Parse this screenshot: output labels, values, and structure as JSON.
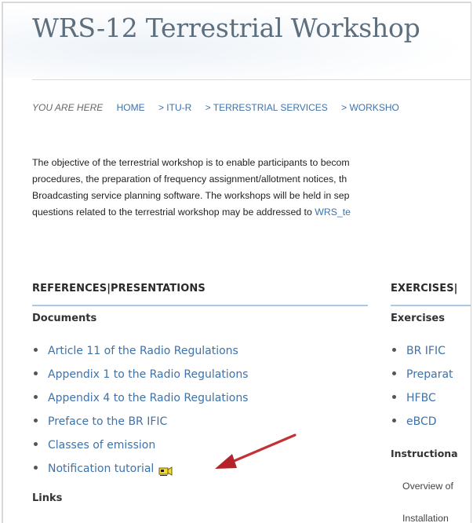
{
  "page": {
    "title": "WRS-12 Terrestrial Workshop"
  },
  "breadcrumb": {
    "here_label": "YOU ARE HERE",
    "items": [
      "HOME",
      "> ITU-R",
      "> TERRESTRIAL SERVICES",
      "> WORKSHO"
    ]
  },
  "intro": {
    "line1": "The objective of the terrestrial workshop is to enable participants to becom",
    "line2": "procedures, the preparation of frequency assignment/allotment notices, th",
    "line3": "Broadcasting service planning software. The workshops will be held in sep",
    "line4_text": "questions related to the terrestrial workshop may be addressed to ",
    "line4_link": "WRS_te"
  },
  "left_column": {
    "heading": "REFERENCES|PRESENTATIONS",
    "documents_heading": "Documents",
    "documents": [
      "Article 11 of the Radio Regulations",
      "Appendix 1 to the Radio Regulations",
      "Appendix 4 to the Radio Regulations",
      "Preface to the BR IFIC",
      "Classes of emission",
      "Notification tutorial"
    ],
    "links_heading": "Links"
  },
  "right_column": {
    "heading": "EXERCISES|",
    "exercises_heading": "Exercises",
    "exercises": [
      "BR IFIC",
      "Preparat",
      "HFBC",
      "eBCD"
    ],
    "instructional_heading": "Instructiona",
    "instructional_items": [
      "Overview of",
      "Installation"
    ]
  },
  "colors": {
    "link": "#3d72ab",
    "rule": "#a9c9e5",
    "title": "#5d6f7e",
    "arrow": "#c0272d"
  },
  "icons": {
    "tutorial_icon": "video-camera-icon",
    "annotation": "red-arrow-icon"
  }
}
